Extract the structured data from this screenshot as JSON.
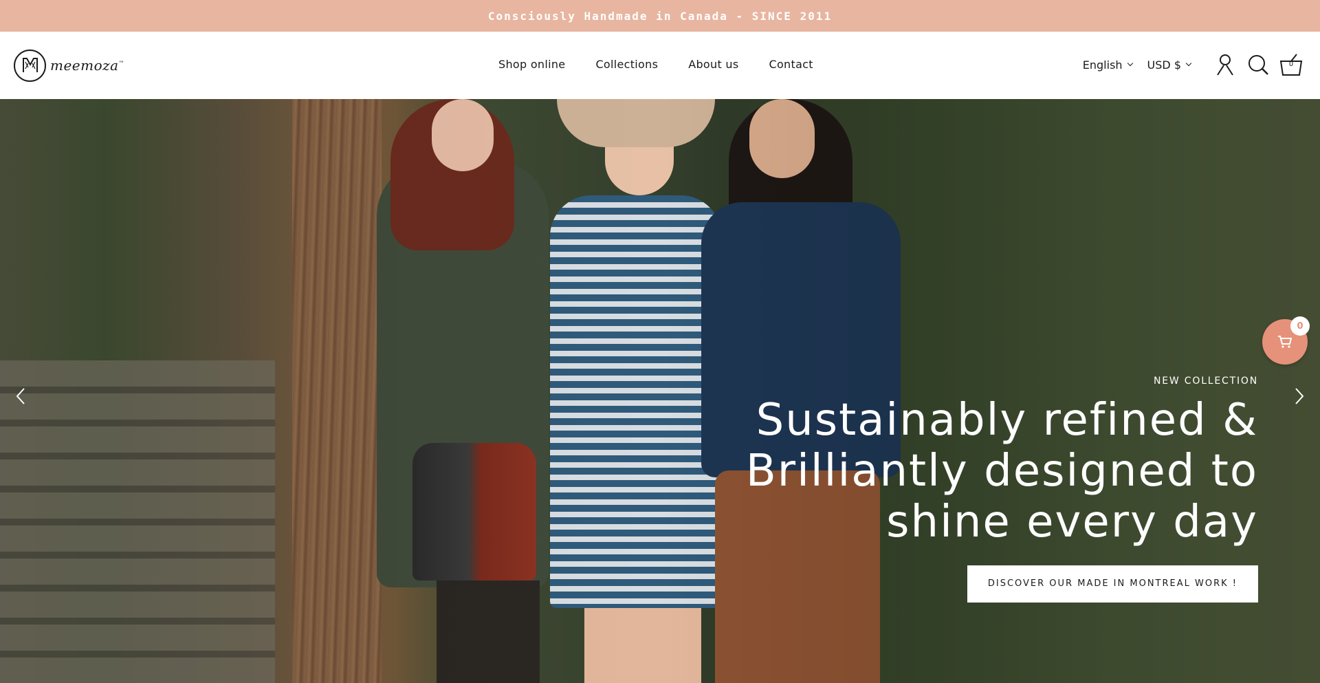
{
  "announcement": {
    "text": "Consciously Handmade in Canada - SINCE 2011"
  },
  "header": {
    "logo_text": "meemoza",
    "logo_tm": "™",
    "nav": [
      {
        "label": "Shop online"
      },
      {
        "label": "Collections"
      },
      {
        "label": "About us"
      },
      {
        "label": "Contact"
      }
    ],
    "language": "English",
    "currency": "USD $",
    "cart_count": "0"
  },
  "hero": {
    "eyebrow": "NEW COLLECTION",
    "headline_lines": [
      "Sustainably refined &",
      "Brilliantly designed to",
      "shine every day"
    ],
    "cta_label": "DISCOVER OUR MADE IN MONTREAL WORK !"
  },
  "floating_cart": {
    "count": "0"
  },
  "colors": {
    "announcement_bg": "#e8b5a0",
    "floating_cart_bg": "#e6917a"
  },
  "icons": [
    "logo-icon",
    "account-icon",
    "search-icon",
    "cart-icon",
    "chevron-left-icon",
    "chevron-right-icon",
    "shopping-cart-icon"
  ]
}
